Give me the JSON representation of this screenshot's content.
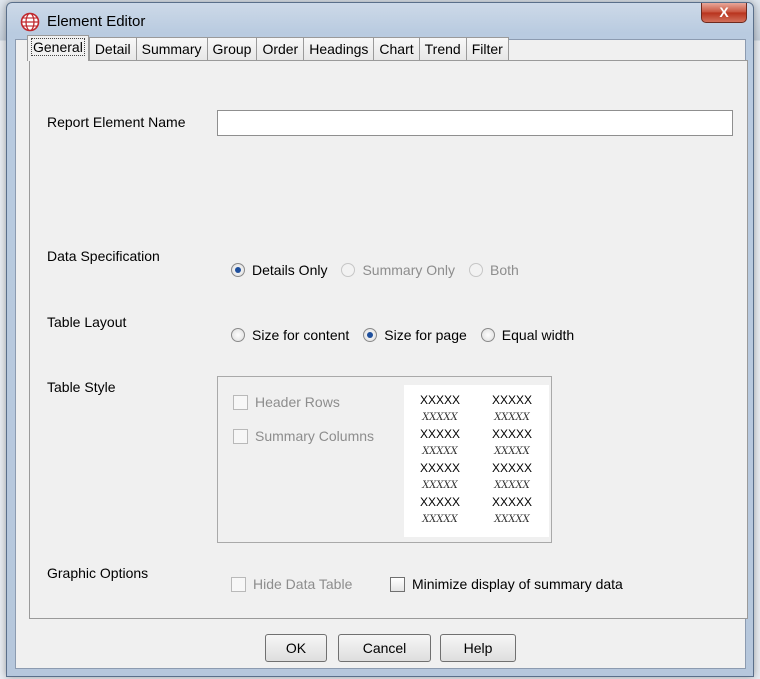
{
  "window": {
    "title": "Element Editor",
    "close_glyph": "X"
  },
  "tabs": [
    "General",
    "Detail",
    "Summary",
    "Group",
    "Order",
    "Headings",
    "Chart",
    "Trend",
    "Filter"
  ],
  "active_tab": "General",
  "general": {
    "report_element_name_label": "Report Element Name",
    "report_element_name_value": "",
    "data_spec_label": "Data Specification",
    "data_spec_options": [
      "Details Only",
      "Summary Only",
      "Both"
    ],
    "table_layout_label": "Table Layout",
    "table_layout_options": [
      "Size for content",
      "Size for page",
      "Equal width"
    ],
    "table_style_label": "Table Style",
    "header_rows_label": "Header Rows",
    "summary_columns_label": "Summary Columns",
    "preview_plain": "XXXXX",
    "preview_italic": "XXXXX",
    "graphic_options_label": "Graphic Options",
    "hide_data_table_label": "Hide Data Table",
    "minimize_label": "Minimize display of summary data"
  },
  "buttons": {
    "ok": "OK",
    "cancel": "Cancel",
    "help": "Help"
  },
  "colors": {
    "radio_selected": "#1e4f9c",
    "close_button": "#c7503a"
  }
}
